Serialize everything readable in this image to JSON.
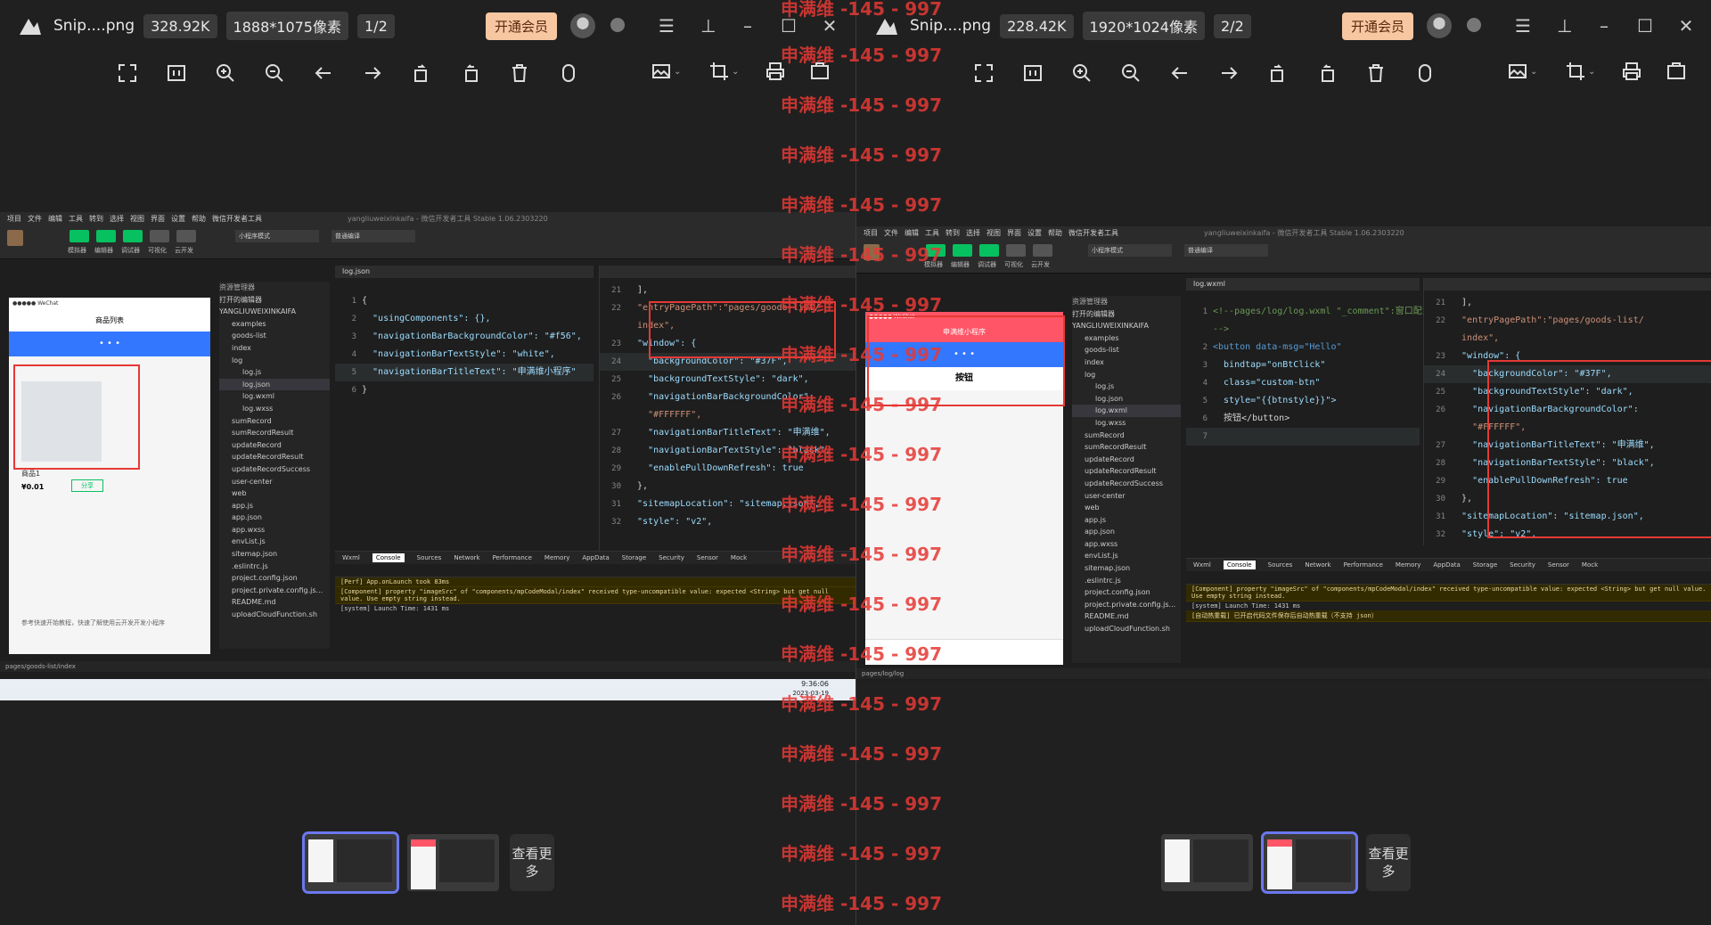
{
  "left_viewer": {
    "filename": "Snip....png",
    "filesize": "328.92K",
    "dimensions": "1888*1075像素",
    "page": "1/2",
    "vip_label": "开通会员",
    "more_label": "查看更多",
    "devtools": {
      "menu": [
        "项目",
        "文件",
        "编辑",
        "工具",
        "转到",
        "选择",
        "视图",
        "界面",
        "设置",
        "帮助",
        "微信开发者工具"
      ],
      "title": "yangliuweixinkaifa - 微信开发者工具 Stable 1.06.2303220",
      "tool_labels": [
        "模拟器",
        "编辑器",
        "调试器",
        "可视化",
        "云开发"
      ],
      "mode": "小程序模式",
      "compile": "普通编译",
      "tab_file": "log.json",
      "phone_title": "商品列表",
      "product_name": "商品1",
      "product_price": "¥0.01",
      "share": "分享",
      "footer_text": "参考快速开始教程，快速了解使用云开发开发小程序",
      "explorer_header": "资源管理器",
      "explorer_items": [
        "打开的编辑器",
        "YANGLIUWEIXINKAIFA",
        "examples",
        "goods-list",
        "index",
        "log",
        "log.js",
        "log.json",
        "log.wxml",
        "log.wxss",
        "sumRecord",
        "sumRecordResult",
        "updateRecord",
        "updateRecordResult",
        "updateRecordSuccess",
        "user-center",
        "web",
        "app.js",
        "app.json",
        "app.wxss",
        "envList.js",
        "sitemap.json",
        ".eslintrc.js",
        "project.config.json",
        "project.private.config.js...",
        "README.md",
        "uploadCloudFunction.sh"
      ],
      "code_left": [
        {
          "n": "1",
          "t": "{"
        },
        {
          "n": "2",
          "t": "  \"usingComponents\": {},"
        },
        {
          "n": "3",
          "t": "  \"navigationBarBackgroundColor\": \"#f56\","
        },
        {
          "n": "4",
          "t": "  \"navigationBarTextStyle\": \"white\","
        },
        {
          "n": "5",
          "t": "  \"navigationBarTitleText\": \"申满维小程序\""
        },
        {
          "n": "6",
          "t": "}"
        }
      ],
      "code_right": [
        {
          "n": "21",
          "t": "  ],"
        },
        {
          "n": "22",
          "t": "  \"entryPagePath\":\"pages/goods-list/"
        },
        {
          "n": "",
          "t": "  index\","
        },
        {
          "n": "23",
          "t": "  \"window\": {"
        },
        {
          "n": "24",
          "t": "    \"backgroundColor\": \"#37F\","
        },
        {
          "n": "25",
          "t": "    \"backgroundTextStyle\": \"dark\","
        },
        {
          "n": "26",
          "t": "    \"navigationBarBackgroundColor\":"
        },
        {
          "n": "",
          "t": "    \"#FFFFFF\","
        },
        {
          "n": "27",
          "t": "    \"navigationBarTitleText\": \"申满维\","
        },
        {
          "n": "28",
          "t": "    \"navigationBarTextStyle\": \"black\","
        },
        {
          "n": "29",
          "t": "    \"enablePullDownRefresh\": true"
        },
        {
          "n": "30",
          "t": "  },"
        },
        {
          "n": "31",
          "t": "  \"sitemapLocation\": \"sitemap.json\","
        },
        {
          "n": "32",
          "t": "  \"style\": \"v2\","
        }
      ],
      "console_tabs": [
        "Wxml",
        "Console",
        "Sources",
        "Network",
        "Performance",
        "Memory",
        "AppData",
        "Storage",
        "Security",
        "Sensor",
        "Mock"
      ],
      "console_lines": [
        "[Perf] App.onLaunch took 83ms",
        "[Component] property \"imageSrc\" of \"components/mpCodeModal/index\" received type-uncompatible value: expected <String> but get null value. Use empty string instead.",
        "[system] Launch Time: 1431 ms"
      ],
      "status_path": "pages/goods-list/index",
      "clock_time": "9:36:06",
      "clock_date": "2023-03-19"
    }
  },
  "right_viewer": {
    "filename": "Snip....png",
    "filesize": "228.42K",
    "dimensions": "1920*1024像素",
    "page": "2/2",
    "vip_label": "开通会员",
    "more_label": "查看更多",
    "devtools": {
      "title": "yangliuweixinkaifa - 微信开发者工具 Stable 1.06.2303220",
      "phone_title": "申满维小程序",
      "button_text": "按钮",
      "tab_file": "log.wxml",
      "code_left": [
        {
          "n": "1",
          "t": "<!--pages/log/log.wxml \"_comment\":窗口配置"
        },
        {
          "n": "",
          "t": "-->"
        },
        {
          "n": "2",
          "t": "<button data-msg=\"Hello\""
        },
        {
          "n": "3",
          "t": "  bindtap=\"onBtClick\""
        },
        {
          "n": "4",
          "t": "  class=\"custom-btn\""
        },
        {
          "n": "5",
          "t": "  style=\"{{btnstyle}}\">"
        },
        {
          "n": "6",
          "t": "  按钮</button>"
        },
        {
          "n": "7",
          "t": ""
        }
      ],
      "code_right": [
        {
          "n": "21",
          "t": "  ],"
        },
        {
          "n": "22",
          "t": "  \"entryPagePath\":\"pages/goods-list/"
        },
        {
          "n": "",
          "t": "  index\","
        },
        {
          "n": "23",
          "t": "  \"window\": {"
        },
        {
          "n": "24",
          "t": "    \"backgroundColor\": \"#37F\","
        },
        {
          "n": "25",
          "t": "    \"backgroundTextStyle\": \"dark\","
        },
        {
          "n": "26",
          "t": "    \"navigationBarBackgroundColor\":"
        },
        {
          "n": "",
          "t": "    \"#FFFFFF\","
        },
        {
          "n": "27",
          "t": "    \"navigationBarTitleText\": \"申满维\","
        },
        {
          "n": "28",
          "t": "    \"navigationBarTextStyle\": \"black\","
        },
        {
          "n": "29",
          "t": "    \"enablePullDownRefresh\": true"
        },
        {
          "n": "30",
          "t": "  },"
        },
        {
          "n": "31",
          "t": "  \"sitemapLocation\": \"sitemap.json\","
        },
        {
          "n": "32",
          "t": "  \"style\": \"v2\","
        }
      ],
      "console_lines": [
        "[Component] property \"imageSrc\" of \"components/mpCodeModal/index\" received type-uncompatible value: expected <String> but get null value. Use empty string instead.",
        "[system] Launch Time: 1431 ms",
        "[自动热重载] 已开启代码文件保存后自动热重载（不支持 json）"
      ],
      "status_path": "pages/log/log"
    }
  },
  "watermark": "申满维 -145 - 997",
  "colors": {
    "accent": "#e53935",
    "wechat_green": "#07c160",
    "bg": "#202020"
  }
}
